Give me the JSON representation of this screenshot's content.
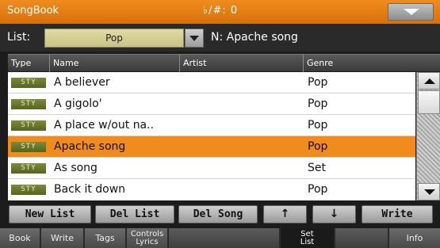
{
  "titlebar": {
    "title": "SongBook",
    "key": "♭/#: 0",
    "menu_icon": "chevron-down-icon"
  },
  "list_row": {
    "label": "List:",
    "selected_list": "Pop",
    "song_name": "N: Apache song"
  },
  "table": {
    "columns": [
      "Type",
      "Name",
      "Artist",
      "Genre"
    ],
    "rows": [
      {
        "type": "STY",
        "name": "A believer",
        "artist": "",
        "genre": "Pop",
        "selected": false
      },
      {
        "type": "STY",
        "name": "A gigolo'",
        "artist": "",
        "genre": "Pop",
        "selected": false
      },
      {
        "type": "STY",
        "name": "A place w/out na..",
        "artist": "",
        "genre": "Pop",
        "selected": false
      },
      {
        "type": "STY",
        "name": "Apache song",
        "artist": "",
        "genre": "Pop",
        "selected": true
      },
      {
        "type": "STY",
        "name": "As song",
        "artist": "",
        "genre": "Set",
        "selected": false
      },
      {
        "type": "STY",
        "name": "Back it down",
        "artist": "",
        "genre": "Pop",
        "selected": false
      }
    ]
  },
  "actions": {
    "new_list": "New List",
    "del_list": "Del List",
    "del_song": "Del Song",
    "move_up": "↑",
    "move_down": "↓",
    "write": "Write"
  },
  "tabs": {
    "book": "Book",
    "write": "Write",
    "tags": "Tags",
    "controls_line1": "Controls",
    "controls_line2": "Lyrics",
    "set_line1": "Set",
    "set_line2": "List",
    "info": "Info"
  },
  "colors": {
    "accent_orange": "#f08c1e",
    "style_badge": "#6b7a2c",
    "list_field": "#d6d096"
  }
}
